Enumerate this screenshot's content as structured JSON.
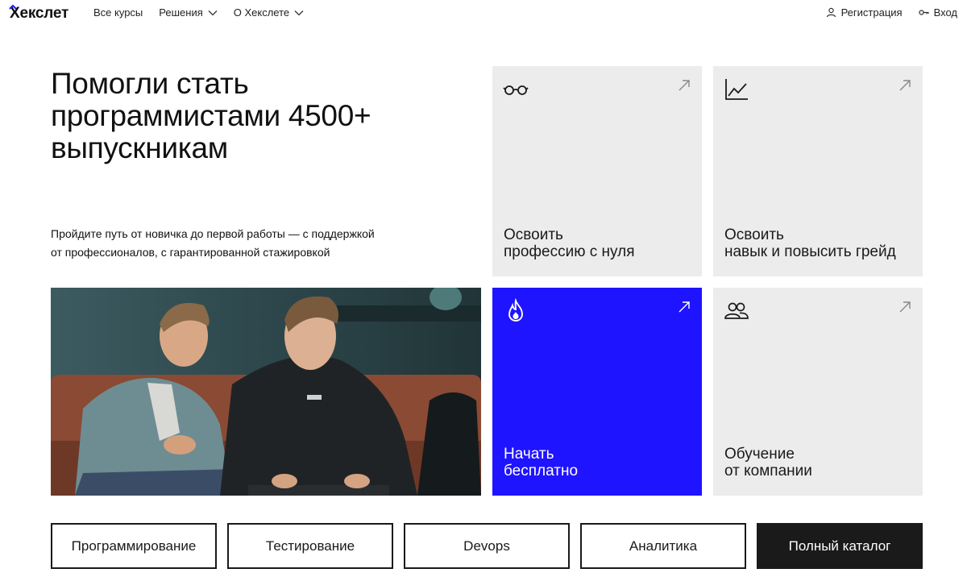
{
  "header": {
    "logo_text": "Хекслет",
    "nav": [
      {
        "label": "Все курсы",
        "has_dropdown": false
      },
      {
        "label": "Решения",
        "has_dropdown": true
      },
      {
        "label": "О Хекслете",
        "has_dropdown": true
      }
    ],
    "register_label": "Регистрация",
    "login_label": "Вход"
  },
  "hero": {
    "title_line1": "Помогли стать",
    "title_line2": "программистами 4500+",
    "title_line3": "выпускникам",
    "subtitle_line1": "Пройдите путь от новичка до первой работы — с поддержкой",
    "subtitle_line2": "от профессионалов, с гарантированной стажировкой"
  },
  "cards": [
    {
      "line1": "Освоить",
      "line2": "профессию с нуля",
      "icon": "glasses-icon"
    },
    {
      "line1": "Освоить",
      "line2": "навык и повысить грейд",
      "icon": "chart-icon"
    },
    {
      "line1": "Начать",
      "line2": "бесплатно",
      "icon": "flame-icon"
    },
    {
      "line1": "Обучение",
      "line2": "от компании",
      "icon": "people-icon"
    }
  ],
  "categories": [
    {
      "label": "Программирование"
    },
    {
      "label": "Тестирование"
    },
    {
      "label": "Devops"
    },
    {
      "label": "Аналитика"
    },
    {
      "label": "Полный каталог"
    }
  ],
  "colors": {
    "accent_blue": "#1f14ff",
    "card_gray": "#ececec",
    "dark_button": "#1a1a1a"
  }
}
